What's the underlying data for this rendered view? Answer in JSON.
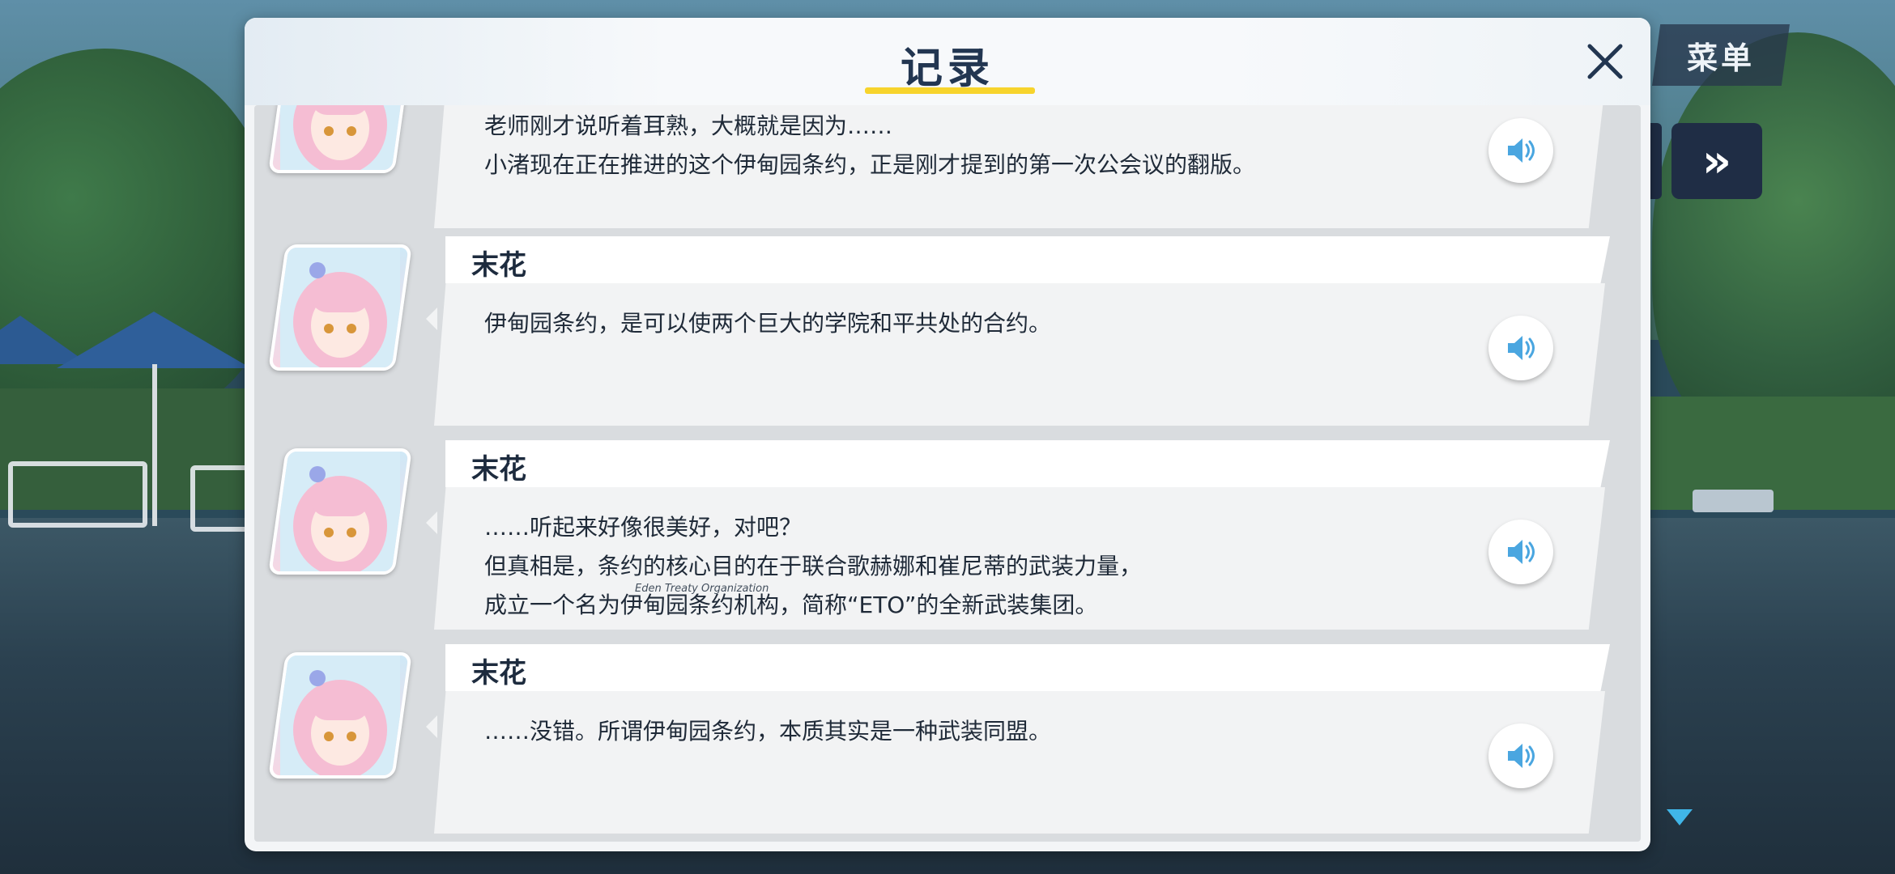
{
  "dialog": {
    "title": "记录",
    "close_icon": "close-icon"
  },
  "hud": {
    "menu_label": "菜单",
    "fast_forward_label": "»"
  },
  "log": [
    {
      "speaker": "",
      "lines": "老师刚才说听着耳熟，大概就是因为……\n小渚现在正在推进的这个伊甸园条约，正是刚才提到的第一次公会议的翻版。",
      "voice_icon": "speaker-icon"
    },
    {
      "speaker": "末花",
      "lines": "伊甸园条约，是可以使两个巨大的学院和平共处的合约。",
      "voice_icon": "speaker-icon"
    },
    {
      "speaker": "末花",
      "lines": "……听起来好像很美好，对吧？\n但真相是，条约的核心目的在于联合歌赫娜和崔尼蒂的武装力量，\n成立一个名为伊甸园条约机构，简称“ETO”的全新武装集团。",
      "ruby": "Eden Treaty Organization",
      "voice_icon": "speaker-icon"
    },
    {
      "speaker": "末花",
      "lines": "……没错。所谓伊甸园条约，本质其实是一种武装同盟。",
      "voice_icon": "speaker-icon"
    }
  ],
  "colors": {
    "title": "#223651",
    "accent_underline": "#f7d42c",
    "voice_icon": "#4aa6e0",
    "scroll_arrow": "#40b6e8"
  }
}
